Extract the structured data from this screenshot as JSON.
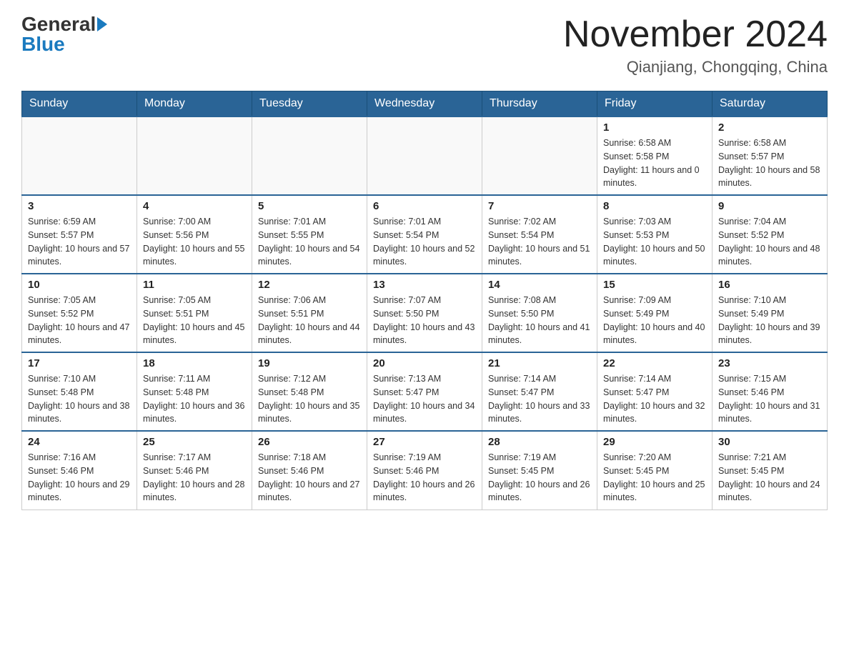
{
  "header": {
    "logo": {
      "general": "General",
      "blue": "Blue"
    },
    "title": "November 2024",
    "location": "Qianjiang, Chongqing, China"
  },
  "calendar": {
    "days_of_week": [
      "Sunday",
      "Monday",
      "Tuesday",
      "Wednesday",
      "Thursday",
      "Friday",
      "Saturday"
    ],
    "weeks": [
      [
        {
          "day": "",
          "info": ""
        },
        {
          "day": "",
          "info": ""
        },
        {
          "day": "",
          "info": ""
        },
        {
          "day": "",
          "info": ""
        },
        {
          "day": "",
          "info": ""
        },
        {
          "day": "1",
          "info": "Sunrise: 6:58 AM\nSunset: 5:58 PM\nDaylight: 11 hours and 0 minutes."
        },
        {
          "day": "2",
          "info": "Sunrise: 6:58 AM\nSunset: 5:57 PM\nDaylight: 10 hours and 58 minutes."
        }
      ],
      [
        {
          "day": "3",
          "info": "Sunrise: 6:59 AM\nSunset: 5:57 PM\nDaylight: 10 hours and 57 minutes."
        },
        {
          "day": "4",
          "info": "Sunrise: 7:00 AM\nSunset: 5:56 PM\nDaylight: 10 hours and 55 minutes."
        },
        {
          "day": "5",
          "info": "Sunrise: 7:01 AM\nSunset: 5:55 PM\nDaylight: 10 hours and 54 minutes."
        },
        {
          "day": "6",
          "info": "Sunrise: 7:01 AM\nSunset: 5:54 PM\nDaylight: 10 hours and 52 minutes."
        },
        {
          "day": "7",
          "info": "Sunrise: 7:02 AM\nSunset: 5:54 PM\nDaylight: 10 hours and 51 minutes."
        },
        {
          "day": "8",
          "info": "Sunrise: 7:03 AM\nSunset: 5:53 PM\nDaylight: 10 hours and 50 minutes."
        },
        {
          "day": "9",
          "info": "Sunrise: 7:04 AM\nSunset: 5:52 PM\nDaylight: 10 hours and 48 minutes."
        }
      ],
      [
        {
          "day": "10",
          "info": "Sunrise: 7:05 AM\nSunset: 5:52 PM\nDaylight: 10 hours and 47 minutes."
        },
        {
          "day": "11",
          "info": "Sunrise: 7:05 AM\nSunset: 5:51 PM\nDaylight: 10 hours and 45 minutes."
        },
        {
          "day": "12",
          "info": "Sunrise: 7:06 AM\nSunset: 5:51 PM\nDaylight: 10 hours and 44 minutes."
        },
        {
          "day": "13",
          "info": "Sunrise: 7:07 AM\nSunset: 5:50 PM\nDaylight: 10 hours and 43 minutes."
        },
        {
          "day": "14",
          "info": "Sunrise: 7:08 AM\nSunset: 5:50 PM\nDaylight: 10 hours and 41 minutes."
        },
        {
          "day": "15",
          "info": "Sunrise: 7:09 AM\nSunset: 5:49 PM\nDaylight: 10 hours and 40 minutes."
        },
        {
          "day": "16",
          "info": "Sunrise: 7:10 AM\nSunset: 5:49 PM\nDaylight: 10 hours and 39 minutes."
        }
      ],
      [
        {
          "day": "17",
          "info": "Sunrise: 7:10 AM\nSunset: 5:48 PM\nDaylight: 10 hours and 38 minutes."
        },
        {
          "day": "18",
          "info": "Sunrise: 7:11 AM\nSunset: 5:48 PM\nDaylight: 10 hours and 36 minutes."
        },
        {
          "day": "19",
          "info": "Sunrise: 7:12 AM\nSunset: 5:48 PM\nDaylight: 10 hours and 35 minutes."
        },
        {
          "day": "20",
          "info": "Sunrise: 7:13 AM\nSunset: 5:47 PM\nDaylight: 10 hours and 34 minutes."
        },
        {
          "day": "21",
          "info": "Sunrise: 7:14 AM\nSunset: 5:47 PM\nDaylight: 10 hours and 33 minutes."
        },
        {
          "day": "22",
          "info": "Sunrise: 7:14 AM\nSunset: 5:47 PM\nDaylight: 10 hours and 32 minutes."
        },
        {
          "day": "23",
          "info": "Sunrise: 7:15 AM\nSunset: 5:46 PM\nDaylight: 10 hours and 31 minutes."
        }
      ],
      [
        {
          "day": "24",
          "info": "Sunrise: 7:16 AM\nSunset: 5:46 PM\nDaylight: 10 hours and 29 minutes."
        },
        {
          "day": "25",
          "info": "Sunrise: 7:17 AM\nSunset: 5:46 PM\nDaylight: 10 hours and 28 minutes."
        },
        {
          "day": "26",
          "info": "Sunrise: 7:18 AM\nSunset: 5:46 PM\nDaylight: 10 hours and 27 minutes."
        },
        {
          "day": "27",
          "info": "Sunrise: 7:19 AM\nSunset: 5:46 PM\nDaylight: 10 hours and 26 minutes."
        },
        {
          "day": "28",
          "info": "Sunrise: 7:19 AM\nSunset: 5:45 PM\nDaylight: 10 hours and 26 minutes."
        },
        {
          "day": "29",
          "info": "Sunrise: 7:20 AM\nSunset: 5:45 PM\nDaylight: 10 hours and 25 minutes."
        },
        {
          "day": "30",
          "info": "Sunrise: 7:21 AM\nSunset: 5:45 PM\nDaylight: 10 hours and 24 minutes."
        }
      ]
    ]
  }
}
